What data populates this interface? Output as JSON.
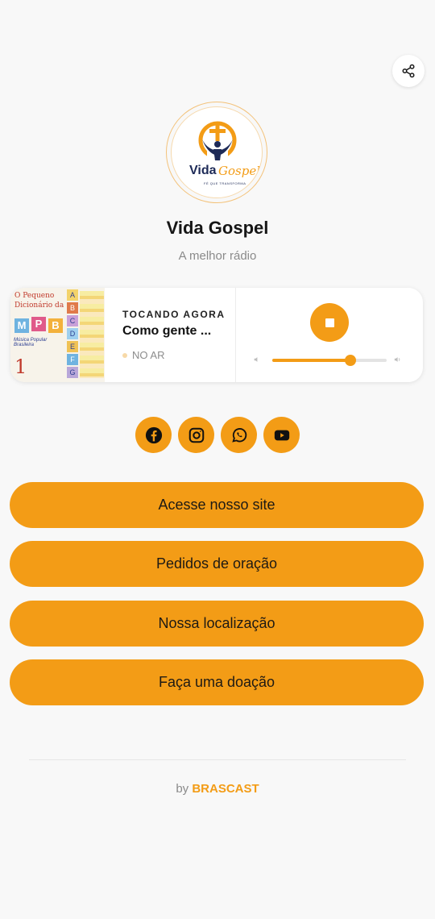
{
  "header": {
    "share_icon": "share-icon"
  },
  "logo": {
    "name": "Vida",
    "script": "Gospel",
    "tagline": "FÉ QUE TRANSFORMA"
  },
  "station": {
    "name": "Vida Gospel",
    "subtitle": "A melhor rádio"
  },
  "player": {
    "cover": {
      "title_line1": "O Pequeno",
      "title_line2": "Dicionário da",
      "letters": [
        "M",
        "P",
        "B"
      ],
      "subtitle": "Música Popular Brasileira",
      "volume_number": "1",
      "side_blocks": [
        "A",
        "B",
        "C",
        "D",
        "E",
        "F",
        "G"
      ]
    },
    "now_playing_label": "TOCANDO AGORA",
    "track_title": "Como gente ...",
    "status": "NO AR",
    "volume": 0.68,
    "stop_icon": "stop-icon"
  },
  "socials": [
    {
      "name": "facebook",
      "icon": "facebook-icon"
    },
    {
      "name": "instagram",
      "icon": "instagram-icon"
    },
    {
      "name": "whatsapp",
      "icon": "whatsapp-icon"
    },
    {
      "name": "youtube",
      "icon": "youtube-icon"
    }
  ],
  "links": [
    {
      "label": "Acesse nosso site"
    },
    {
      "label": "Pedidos de oração"
    },
    {
      "label": "Nossa localização"
    },
    {
      "label": "Faça uma doação"
    }
  ],
  "footer": {
    "by": "by",
    "brand": "BRASCAST"
  },
  "colors": {
    "accent": "#f39c16",
    "background": "#f8f8f8",
    "text": "#161616",
    "muted": "#8a8a8a",
    "logo_blue": "#1d2a57"
  }
}
